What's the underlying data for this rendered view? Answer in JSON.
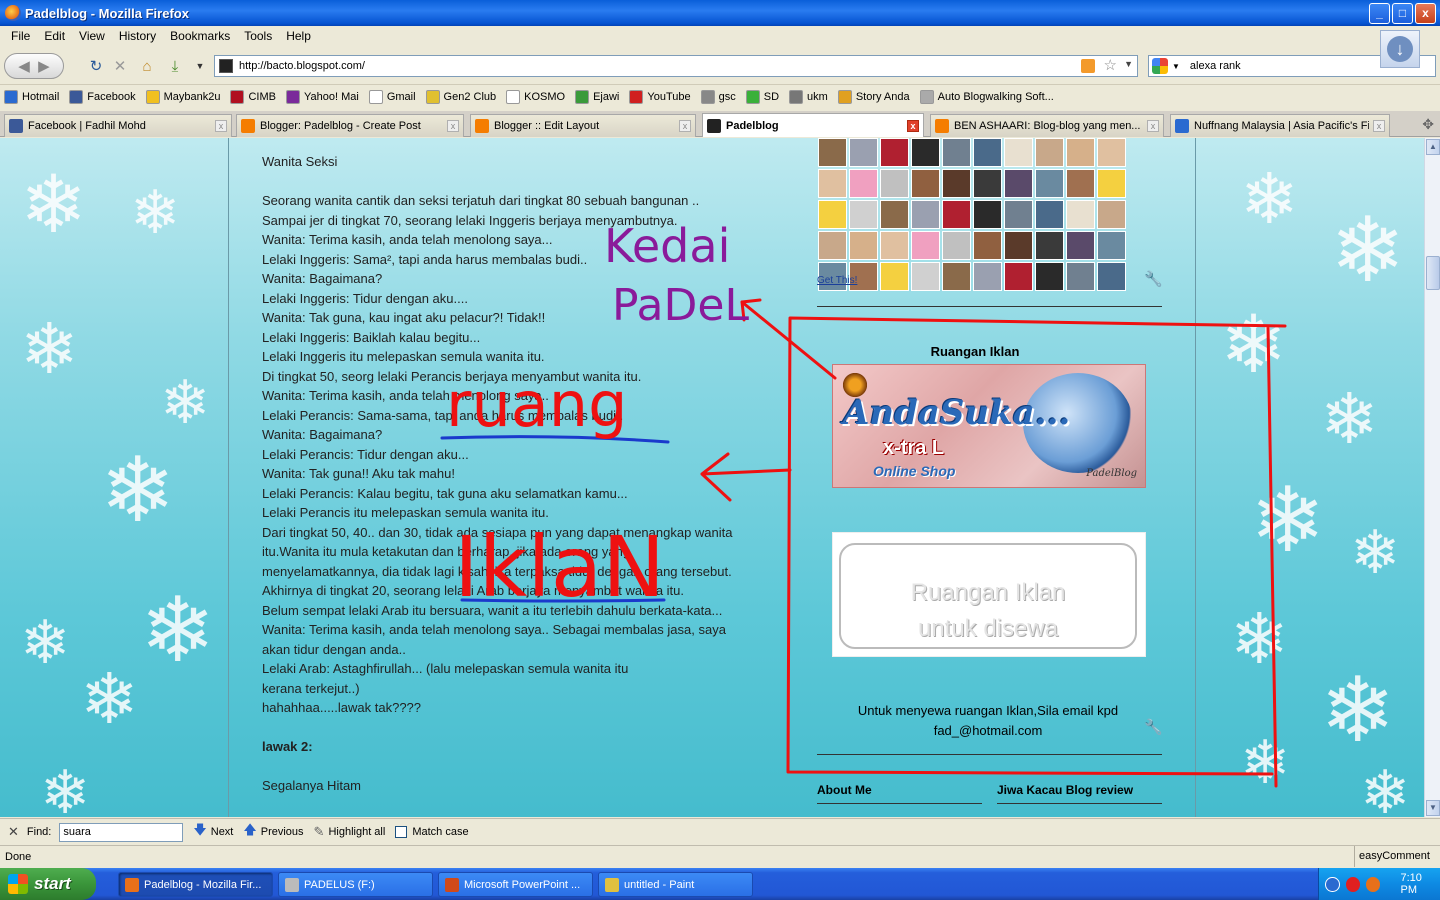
{
  "window": {
    "title": "Padelblog - Mozilla Firefox",
    "buttons": [
      "_",
      "□",
      "x"
    ]
  },
  "menu": [
    "File",
    "Edit",
    "View",
    "History",
    "Bookmarks",
    "Tools",
    "Help"
  ],
  "nav": {
    "url": "http://bacto.blogspot.com/",
    "search_value": "alexa rank"
  },
  "bookmarks": [
    {
      "label": "Hotmail",
      "color": "#2a6ad0"
    },
    {
      "label": "Facebook",
      "color": "#3b5998"
    },
    {
      "label": "Maybank2u",
      "color": "#f0c020"
    },
    {
      "label": "CIMB",
      "color": "#b01020"
    },
    {
      "label": "Yahoo! Mai",
      "color": "#7a2a9a"
    },
    {
      "label": "Gmail",
      "color": "#ffffff"
    },
    {
      "label": "Gen2 Club",
      "color": "#e0c030"
    },
    {
      "label": "KOSMO",
      "color": "#ffffff"
    },
    {
      "label": "Ejawi",
      "color": "#3a9a3a"
    },
    {
      "label": "YouTube",
      "color": "#d02020"
    },
    {
      "label": "gsc",
      "color": "#888888"
    },
    {
      "label": "SD",
      "color": "#3ab03a"
    },
    {
      "label": "ukm",
      "color": "#777777"
    },
    {
      "label": "Story Anda",
      "color": "#e0a020"
    },
    {
      "label": "Auto Blogwalking Soft...",
      "color": "#aaaaaa"
    }
  ],
  "tabs": [
    {
      "label": "Facebook | Fadhil Mohd",
      "color": "#3b5998"
    },
    {
      "label": "Blogger: Padelblog - Create Post",
      "color": "#f57d00"
    },
    {
      "label": "Blogger :: Edit Layout",
      "color": "#f57d00"
    },
    {
      "label": "Padelblog",
      "color": "#222222"
    },
    {
      "label": "BEN ASHAARI: Blog-blog yang men...",
      "color": "#f57d00"
    },
    {
      "label": "Nuffnang Malaysia | Asia Pacific's Fi...",
      "color": "#2a6ad0"
    }
  ],
  "post": {
    "lines": [
      "Wanita Seksi",
      "",
      "Seorang wanita cantik dan seksi terjatuh dari tingkat 80 sebuah bangunan ..",
      "Sampai jer di tingkat 70, seorang lelaki Inggeris berjaya menyambutnya.",
      "Wanita: Terima kasih, anda telah menolong saya...",
      "Lelaki Inggeris: Sama², tapi anda harus membalas budi..",
      "Wanita: Bagaimana?",
      "Lelaki Inggeris: Tidur dengan aku....",
      "Wanita: Tak guna, kau ingat aku pelacur?! Tidak!!",
      "Lelaki Inggeris: Baiklah kalau begitu...",
      "Lelaki Inggeris itu melepaskan semula wanita itu.",
      "Di tingkat 50, seorg lelaki Perancis berjaya menyambut wanita itu.",
      "Wanita: Terima kasih, anda telah menolong saya..",
      "Lelaki Perancis: Sama-sama, tapi anda harus membalas budi..",
      "Wanita: Bagaimana?",
      "Lelaki Perancis: Tidur dengan aku...",
      "Wanita: Tak guna!! Aku tak mahu!",
      "Lelaki Perancis: Kalau begitu, tak guna aku selamatkan kamu...",
      "Lelaki Perancis itu melepaskan semula wanita itu.",
      "Dari tingkat 50, 40.. dan 30, tidak ada sesiapa pun yang dapat menangkap wanita",
      "itu.Wanita itu mula ketakutan dan berharap, jika ada orang yang",
      "menyelamatkannya, dia tidak lagi kisah jika terpaksa tidur dengan orang tersebut.",
      "Akhirnya di tingkat 20, seorang lelaki Arab berjaya menyambut wanita itu.",
      "Belum sempat lelaki Arab itu bersuara, wanit a itu terlebih dahulu berkata-kata...",
      "Wanita: Terima kasih, anda telah menolong saya.. Sebagai membalas jasa, saya",
      "akan tidur dengan anda..",
      "Lelaki Arab: Astaghfirullah... (lalu melepaskan semula wanita itu",
      "kerana terkejut..)",
      "hahahhaa.....lawak tak????",
      "",
      "lawak 2:",
      "",
      "Segalanya Hitam"
    ]
  },
  "sidebar": {
    "get_this": "Get This!",
    "iklan_title": "Ruangan Iklan",
    "banner1": {
      "brand": "AndaSuka...",
      "sub": "x-tra L",
      "shop": "Online Shop",
      "sig": "PadelBlog"
    },
    "banner2": {
      "text_line1": "Ruangan Iklan",
      "text_line2": "untuk disewa"
    },
    "iklan_note_line1": "Untuk menyewa ruangan Iklan,Sila email kpd",
    "iklan_note_line2": "fad_@hotmail.com",
    "about_me": "About Me",
    "jiwa_kacau": "Jiwa Kacau Blog review"
  },
  "findbar": {
    "label": "Find:",
    "value": "suara",
    "next": "Next",
    "previous": "Previous",
    "highlight": "Highlight all",
    "match_case": "Match case"
  },
  "status": {
    "left": "Done",
    "right": "easyComment"
  },
  "taskbar": {
    "start": "start",
    "tasks": [
      {
        "label": "Padelblog - Mozilla Fir...",
        "color": "#e8701a"
      },
      {
        "label": "PADELUS (F:)",
        "color": "#bbbbbb"
      },
      {
        "label": "Microsoft PowerPoint ...",
        "color": "#d04a1a"
      },
      {
        "label": "untitled - Paint",
        "color": "#e0c040"
      }
    ],
    "clock": "7:10 PM"
  },
  "annotations": {
    "handwriting_1": "Kedai",
    "handwriting_2": "PaDeL",
    "handwriting_3": "ruang",
    "handwriting_4": "IklaN",
    "colors": {
      "purple": "#8a1a9a",
      "red": "#ee1111",
      "blue": "#1a3acc"
    }
  }
}
